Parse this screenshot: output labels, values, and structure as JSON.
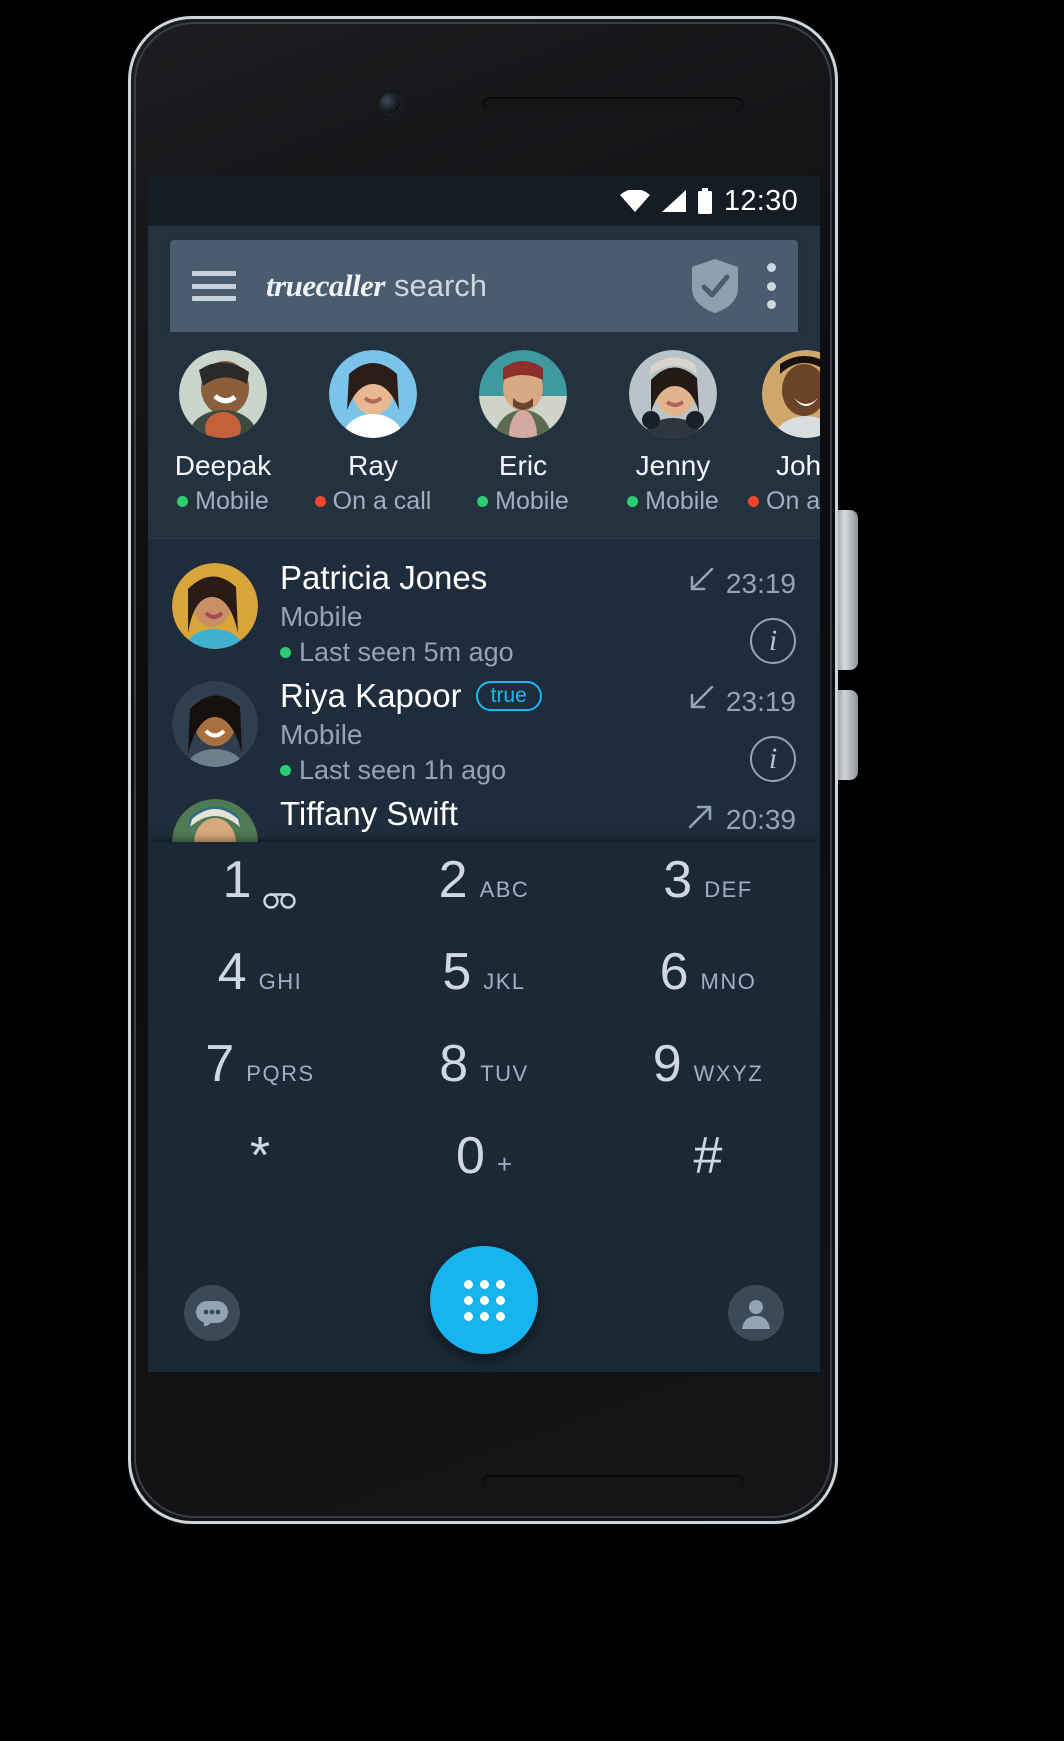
{
  "status_bar": {
    "time": "12:30",
    "icons": [
      "wifi-icon",
      "signal-icon",
      "battery-icon"
    ]
  },
  "appbar": {
    "menu_icon": "hamburger-menu-icon",
    "brand": "truecaller",
    "brand_suffix": "search",
    "shield_icon": "shield-check-icon",
    "overflow_icon": "kebab-menu-icon"
  },
  "favourites": [
    {
      "name": "Deepak",
      "status": "Mobile",
      "status_color": "#2ecc71"
    },
    {
      "name": "Ray",
      "status": "On a call",
      "status_color": "#f0452f"
    },
    {
      "name": "Eric",
      "status": "Mobile",
      "status_color": "#2ecc71"
    },
    {
      "name": "Jenny",
      "status": "Mobile",
      "status_color": "#2ecc71"
    },
    {
      "name": "John",
      "status": "On a call",
      "status_color": "#f0452f"
    }
  ],
  "calls": [
    {
      "name": "Patricia Jones",
      "badge": "",
      "line": "Mobile",
      "seen": "Last seen 5m ago",
      "seen_color": "#2ecc71",
      "time": "23:19",
      "direction": "incoming",
      "info_icon": "info-icon"
    },
    {
      "name": "Riya Kapoor",
      "badge": "true",
      "line": "Mobile",
      "seen": "Last seen 1h ago",
      "seen_color": "#2ecc71",
      "time": "23:19",
      "direction": "incoming",
      "info_icon": "info-icon"
    },
    {
      "name": "Tiffany Swift",
      "badge": "",
      "line": "",
      "seen": "",
      "seen_color": "#2ecc71",
      "time": "20:39",
      "direction": "outgoing",
      "info_icon": "info-icon"
    }
  ],
  "dialpad": {
    "keys": [
      {
        "digit": "1",
        "letters": "",
        "icon": "voicemail-icon"
      },
      {
        "digit": "2",
        "letters": "ABC",
        "icon": ""
      },
      {
        "digit": "3",
        "letters": "DEF",
        "icon": ""
      },
      {
        "digit": "4",
        "letters": "GHI",
        "icon": ""
      },
      {
        "digit": "5",
        "letters": "JKL",
        "icon": ""
      },
      {
        "digit": "6",
        "letters": "MNO",
        "icon": ""
      },
      {
        "digit": "7",
        "letters": "PQRS",
        "icon": ""
      },
      {
        "digit": "8",
        "letters": "TUV",
        "icon": ""
      },
      {
        "digit": "9",
        "letters": "WXYZ",
        "icon": ""
      },
      {
        "digit": "*",
        "letters": "",
        "icon": ""
      },
      {
        "digit": "0",
        "letters": "+",
        "icon": ""
      },
      {
        "digit": "#",
        "letters": "",
        "icon": ""
      }
    ],
    "messages_icon": "chat-bubble-icon",
    "dialpad_fab_icon": "dialpad-icon",
    "contacts_icon": "person-icon",
    "fab_color": "#18b4f0"
  },
  "theme": {
    "screen_bg": "#1d2b3a",
    "appbar_bg": "#4a5c6e",
    "favs_bg": "#24323f",
    "list_bg": "#1e2c3b",
    "dialpad_bg": "#1b2836",
    "accent": "#18b4f0",
    "true_badge": "#19b9f5"
  }
}
